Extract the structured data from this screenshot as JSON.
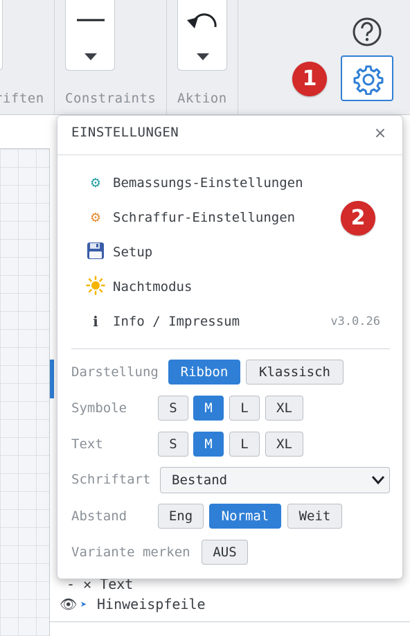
{
  "ribbon": {
    "groups": [
      {
        "label": "riften"
      },
      {
        "label": "Constraints"
      },
      {
        "label": "Aktion"
      }
    ],
    "help_icon": "question-circle-icon",
    "settings_icon": "gear-icon",
    "accent": "#2f7fd6"
  },
  "markers": {
    "one": "1",
    "two": "2",
    "color": "#d32a2a"
  },
  "popup": {
    "title": "EINSTELLUNGEN",
    "close": "×",
    "menu": [
      {
        "icon": "⚙",
        "icon_name": "gear-teal-icon",
        "icon_color": "#1a9aa0",
        "label": "Bemassungs-Einstellungen"
      },
      {
        "icon": "⚙",
        "icon_name": "gear-orange-icon",
        "icon_color": "#e8872a",
        "label": "Schraffur-Einstellungen"
      },
      {
        "icon": "💾",
        "icon_name": "floppy-disk-icon",
        "icon_color": "#3a5ea8",
        "label": "Setup"
      },
      {
        "icon": "☀",
        "icon_name": "sun-icon",
        "icon_color": "#f0a800",
        "label": "Nachtmodus"
      },
      {
        "icon": "ℹ",
        "icon_name": "info-icon",
        "icon_color": "#3b4046",
        "label": "Info / Impressum",
        "version": "v3.0.26"
      }
    ],
    "options": {
      "darstellung": {
        "label": "Darstellung",
        "choices": [
          "Ribbon",
          "Klassisch"
        ],
        "selected": "Ribbon"
      },
      "symbole": {
        "label": "Symbole",
        "choices": [
          "S",
          "M",
          "L",
          "XL"
        ],
        "selected": "M"
      },
      "text": {
        "label": "Text",
        "choices": [
          "S",
          "M",
          "L",
          "XL"
        ],
        "selected": "M"
      },
      "schriftart": {
        "label": "Schriftart",
        "value": "Bestand"
      },
      "abstand": {
        "label": "Abstand",
        "choices": [
          "Eng",
          "Normal",
          "Weit"
        ],
        "selected": "Normal"
      },
      "variante": {
        "label": "Variante merken",
        "value": "AUS"
      }
    }
  },
  "workspace": {
    "partial_row": "- ✕ Text",
    "layer_row": {
      "eye_icon": "👁",
      "arrow": "➤",
      "label": "Hinweispfeile"
    }
  }
}
